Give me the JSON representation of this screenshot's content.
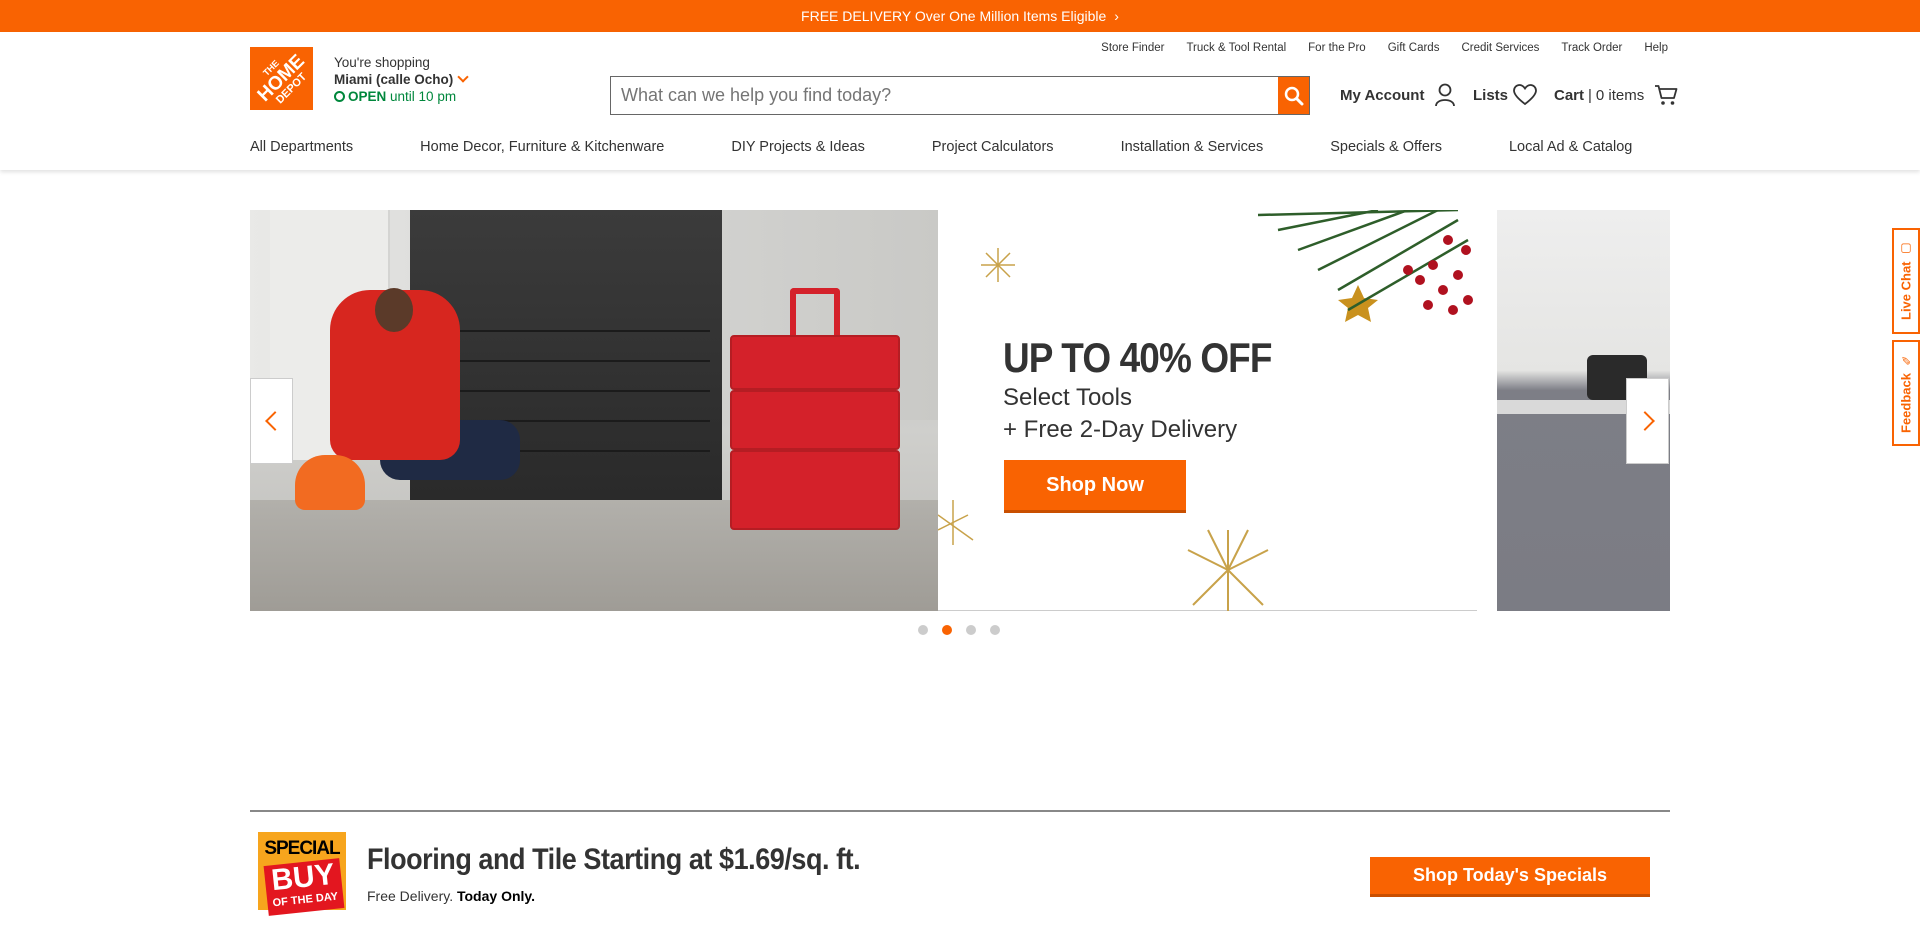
{
  "top_bar": {
    "text": "FREE DELIVERY Over One Million Items Eligible"
  },
  "logo": {
    "line1": "THE",
    "line2": "HOME",
    "line3": "DEPOT"
  },
  "store": {
    "prefix": "You're shopping",
    "name": "Miami (calle Ocho)",
    "open_label": "OPEN",
    "hours": "until 10 pm"
  },
  "utility_links": [
    "Store Finder",
    "Truck & Tool Rental",
    "For the Pro",
    "Gift Cards",
    "Credit Services",
    "Track Order",
    "Help"
  ],
  "search": {
    "placeholder": "What can we help you find today?"
  },
  "account": {
    "label": "My Account"
  },
  "lists": {
    "label": "Lists"
  },
  "cart": {
    "label": "Cart",
    "separator": "|",
    "items": "0 items"
  },
  "nav": [
    "All Departments",
    "Home Decor, Furniture & Kitchenware",
    "DIY Projects & Ideas",
    "Project Calculators",
    "Installation & Services",
    "Specials & Offers",
    "Local Ad & Catalog"
  ],
  "hero": {
    "headline": "UP TO 40% OFF",
    "line1": "Select Tools",
    "line2": "+ Free 2-Day Delivery",
    "cta": "Shop Now",
    "slide_count": 4,
    "active_slide": 2
  },
  "side_tabs": {
    "chat": "Live Chat",
    "feedback": "Feedback"
  },
  "special_buy": {
    "badge_top": "SPECIAL",
    "badge_mid": "BUY",
    "badge_bottom": "OF THE DAY",
    "title": "Flooring and Tile Starting at $1.69/sq. ft.",
    "delivery": "Free Delivery.",
    "today": "Today Only.",
    "cta": "Shop Today's Specials"
  },
  "colors": {
    "brand": "#f96302",
    "open_green": "#00873c"
  }
}
